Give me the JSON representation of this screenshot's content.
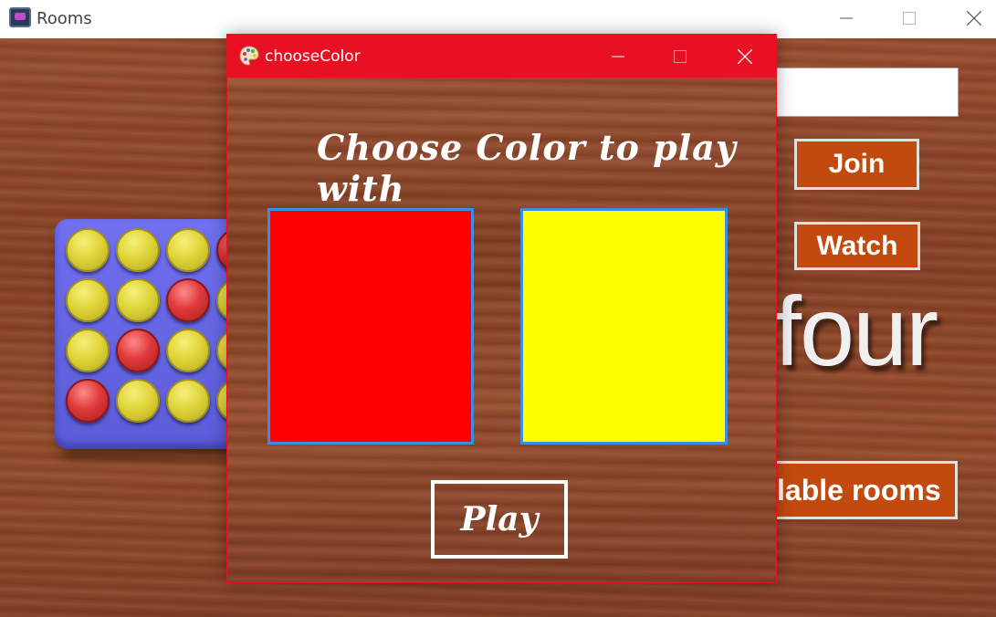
{
  "main_window": {
    "title": "Rooms",
    "join_label": "Join",
    "watch_label": "Watch",
    "rooms_label": "lable rooms",
    "logo_text": "four",
    "board": {
      "rows": [
        [
          "yellow",
          "yellow",
          "yellow",
          "red"
        ],
        [
          "yellow",
          "yellow",
          "red",
          "yellow"
        ],
        [
          "yellow",
          "red",
          "yellow",
          "yellow"
        ],
        [
          "red",
          "yellow",
          "yellow",
          "yellow"
        ]
      ]
    }
  },
  "dialog": {
    "title": "chooseColor",
    "heading": "Choose Color to play with",
    "colors": [
      {
        "name": "red",
        "hex": "#ff0000"
      },
      {
        "name": "yellow",
        "hex": "#ffff00"
      }
    ],
    "play_label": "Play"
  },
  "theme": {
    "dialog_titlebar": "#e81123",
    "button_orange": "#c24a0e",
    "wood": "#8d4a2c",
    "swatch_border": "#3d8ee0"
  }
}
